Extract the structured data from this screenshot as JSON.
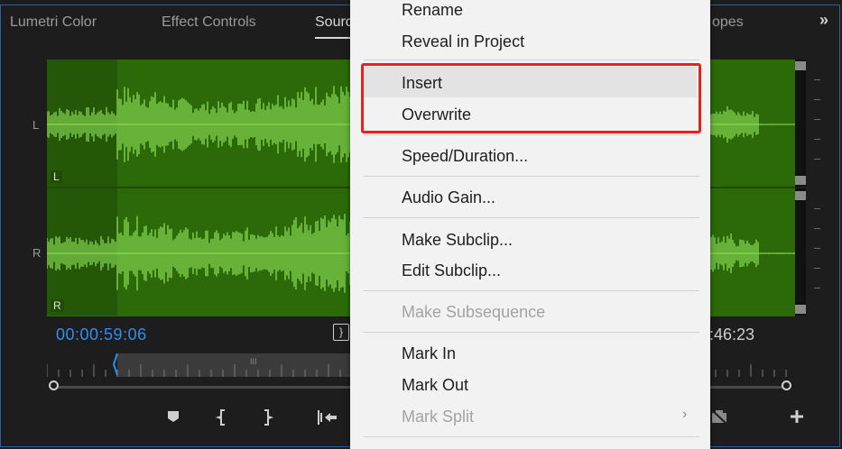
{
  "tabs": [
    {
      "label": "Lumetri Color"
    },
    {
      "label": "Effect Controls"
    },
    {
      "label": "Sourc"
    },
    {
      "label": "opes"
    }
  ],
  "more_tabs_label": "»",
  "channels": {
    "left": "L",
    "right": "R"
  },
  "timecode": {
    "current": "00:00:59:06",
    "duration": ":46:23"
  },
  "ruler_mark": "III",
  "context_menu": {
    "items": [
      {
        "label": "Rename",
        "enabled": true
      },
      {
        "label": "Reveal in Project",
        "enabled": true
      },
      {
        "label": "Insert",
        "enabled": true,
        "hovered": true
      },
      {
        "label": "Overwrite",
        "enabled": true
      },
      {
        "label": "Speed/Duration...",
        "enabled": true
      },
      {
        "label": "Audio Gain...",
        "enabled": true
      },
      {
        "label": "Make Subclip...",
        "enabled": true
      },
      {
        "label": "Edit Subclip...",
        "enabled": true
      },
      {
        "label": "Make Subsequence",
        "enabled": false
      },
      {
        "label": "Mark In",
        "enabled": true
      },
      {
        "label": "Mark Out",
        "enabled": true
      },
      {
        "label": "Mark Split",
        "enabled": false,
        "has_submenu": true
      }
    ]
  },
  "colors": {
    "waveform_bg": "#2c6a09",
    "waveform": "#8fe25a",
    "timecode_accent": "#2f8fef",
    "highlight": "#e8211f"
  },
  "icons": {
    "add_marker": "marker-icon",
    "mark_in": "mark-in-icon",
    "mark_out": "mark-out-icon",
    "go_to_in": "go-to-in-icon",
    "export_frame": "camera-icon",
    "add": "plus-icon"
  }
}
